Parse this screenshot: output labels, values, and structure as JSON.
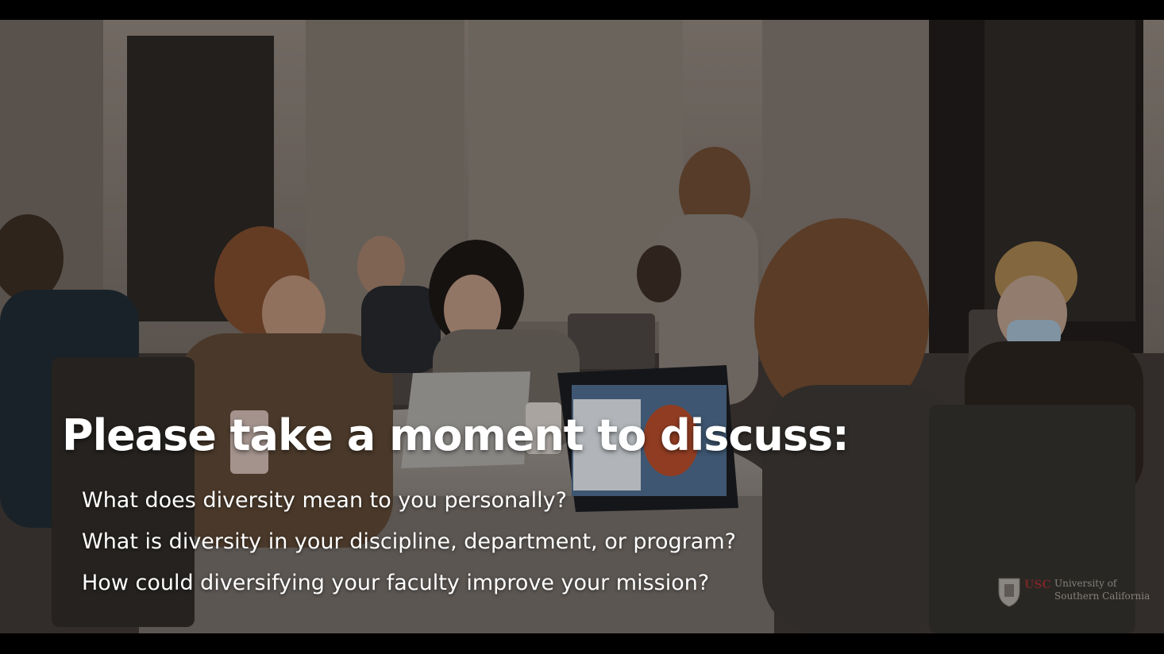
{
  "slide": {
    "headline": "Please take a moment to discuss:",
    "questions": [
      "What does diversity mean to you personally?",
      "What is diversity in your discipline, department, or program?",
      "How could diversifying your faculty improve your mission?"
    ]
  },
  "logo": {
    "abbr": "USC",
    "line1": "University of",
    "line2": "Southern California",
    "icon": "shield-icon"
  },
  "colors": {
    "headline_text": "#ffffff",
    "background_dim": "#000000",
    "logo_accent": "#b3262a"
  }
}
